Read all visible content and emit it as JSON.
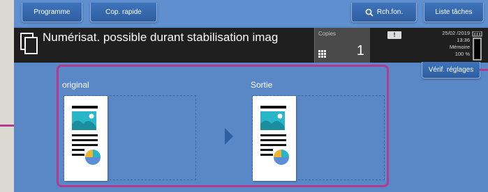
{
  "toolbar": {
    "programme_label": "Programme",
    "cop_rapide_label": "Cop. rapide",
    "rch_fon_label": "Rch.fon.",
    "liste_taches_label": "Liste tâches"
  },
  "header": {
    "title": "Numérisat. possible durant stabilisation imag",
    "copies_label": "Copies",
    "copies_value": "1",
    "warning_symbol": "!",
    "date": "25/02 /2019",
    "time": "13:36",
    "memory_label": "Mémoire",
    "memory_value": "100 %"
  },
  "verif_label": "Vérif. réglages",
  "preview": {
    "original_label": "original",
    "output_label": "Sortie"
  },
  "colors": {
    "screen_bg": "#5a87c6",
    "header_bg": "#1f1f1f",
    "button_bg": "#3a6cb3",
    "callout": "#b33b8f",
    "cyan": "#29b6c8",
    "chart_yellow": "#f1b431",
    "chart_blue": "#5a8ed6"
  },
  "icons": [
    "document-stack-icon",
    "search-icon",
    "keypad-icon",
    "warning-icon",
    "memory-icon",
    "play-arrow-icon",
    "page-icon"
  ]
}
